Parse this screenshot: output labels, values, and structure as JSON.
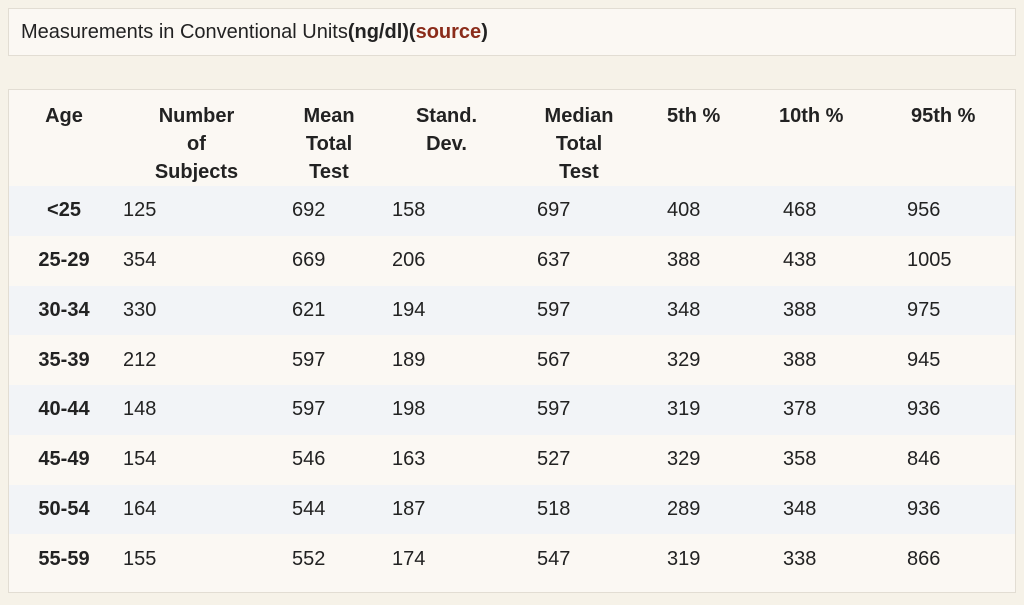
{
  "title": {
    "prefix": "Measurements in Conventional Units ",
    "unit": "(ng/dl)",
    "open_paren": " (",
    "source_label": "source",
    "close_paren": ")"
  },
  "table": {
    "headers": [
      [
        "Age"
      ],
      [
        "Number",
        "of",
        "Subjects"
      ],
      [
        "Mean",
        "Total",
        "Test"
      ],
      [
        "Stand.",
        "Dev."
      ],
      [
        "Median",
        "Total",
        "Test"
      ],
      [
        "5th %"
      ],
      [
        "10th %"
      ],
      [
        "95th %"
      ]
    ],
    "rows": [
      [
        "<25",
        "125",
        "692",
        "158",
        "697",
        "408",
        "468",
        "956"
      ],
      [
        "25-29",
        "354",
        "669",
        "206",
        "637",
        "388",
        "438",
        "1005"
      ],
      [
        "30-34",
        "330",
        "621",
        "194",
        "597",
        "348",
        "388",
        "975"
      ],
      [
        "35-39",
        "212",
        "597",
        "189",
        "567",
        "329",
        "388",
        "945"
      ],
      [
        "40-44",
        "148",
        "597",
        "198",
        "597",
        "319",
        "378",
        "936"
      ],
      [
        "45-49",
        "154",
        "546",
        "163",
        "527",
        "329",
        "358",
        "846"
      ],
      [
        "50-54",
        "164",
        "544",
        "187",
        "518",
        "289",
        "348",
        "936"
      ],
      [
        "55-59",
        "155",
        "552",
        "174",
        "547",
        "319",
        "338",
        "866"
      ]
    ]
  }
}
